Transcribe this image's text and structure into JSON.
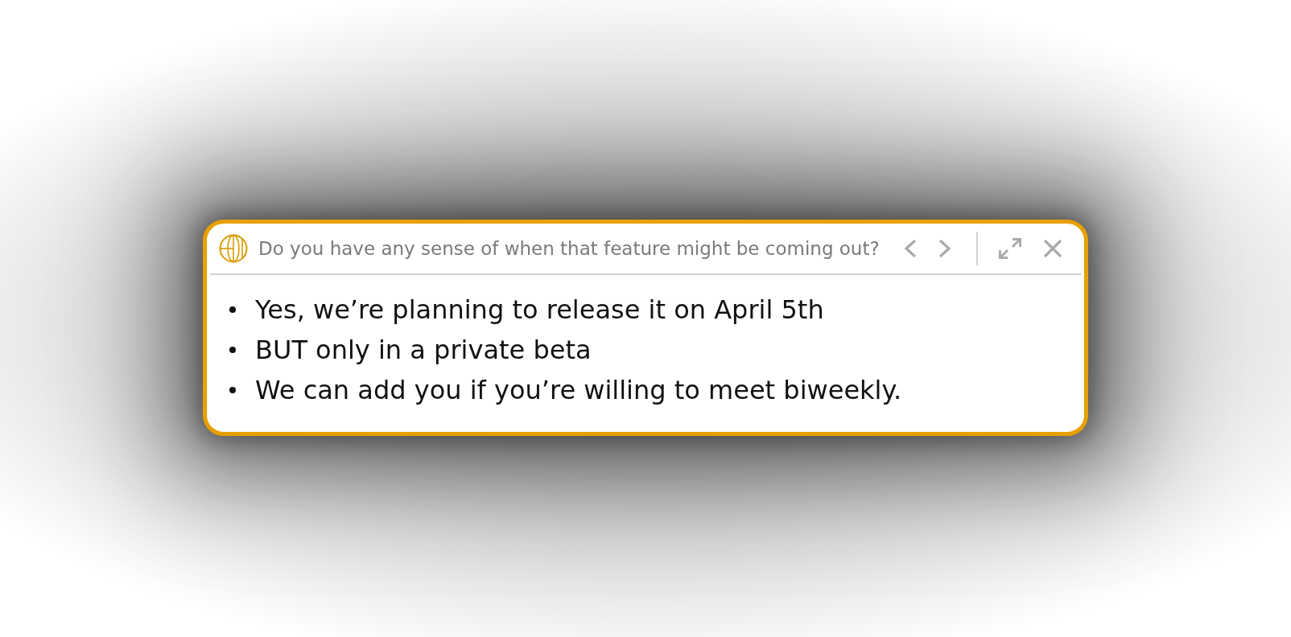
{
  "popup": {
    "question": "Do you have any sense of when that feature might be coming out?"
  },
  "answer": {
    "bullets": [
      "Yes, we’re planning to release it on April 5th",
      "BUT only in a private beta",
      "We can add you if you’re willing to meet biweekly."
    ]
  }
}
